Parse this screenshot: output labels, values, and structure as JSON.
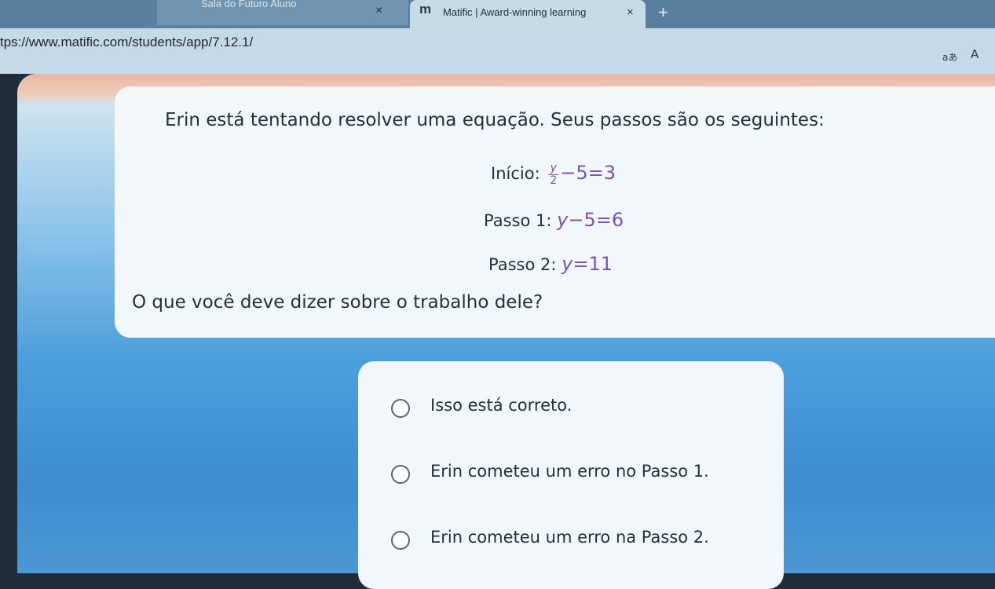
{
  "browser": {
    "prev_tab_title": "Sala do Futuro Aluno",
    "prev_tab_close": "×",
    "active_tab_logo": "m",
    "active_tab_title": "Matific | Award-winning learning",
    "active_tab_close": "×",
    "new_tab": "+",
    "url": "tps://www.matific.com/students/app/7.12.1/",
    "read_aloud": "aあ",
    "font_size": "A"
  },
  "question": {
    "prompt": "Erin está tentando resolver uma equação. Seus passos são os seguintes:",
    "start_label": "Início:",
    "start_num": "y",
    "start_den": "2",
    "start_rest": "−5=3",
    "step1_label": "Passo 1:",
    "step1_var": "y",
    "step1_rest": "−5=6",
    "step2_label": "Passo 2:",
    "step2_var": "y",
    "step2_rest": "=11",
    "ask": "O que você deve dizer sobre o trabalho dele?"
  },
  "options": [
    {
      "label": "Isso está correto."
    },
    {
      "label": "Erin cometeu um erro no Passo 1."
    },
    {
      "label": "Erin cometeu um erro na Passo 2."
    }
  ],
  "colors": {
    "math": "#7c52b8",
    "card": "#f2f7fb",
    "text": "#24303b"
  }
}
